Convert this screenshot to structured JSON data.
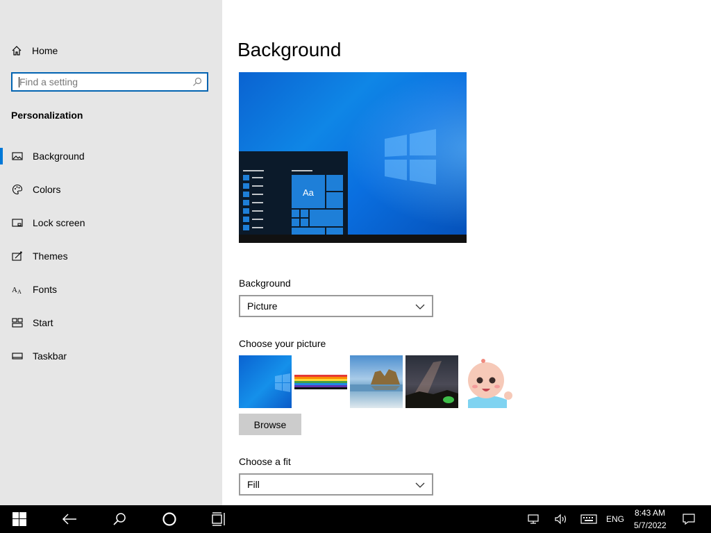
{
  "sidebar": {
    "home_label": "Home",
    "search": {
      "placeholder": "Find a setting",
      "icon": "search-icon"
    },
    "section_title": "Personalization",
    "items": [
      {
        "label": "Background",
        "icon": "picture-icon",
        "active": true
      },
      {
        "label": "Colors",
        "icon": "palette-icon",
        "active": false
      },
      {
        "label": "Lock screen",
        "icon": "lock-screen-icon",
        "active": false
      },
      {
        "label": "Themes",
        "icon": "themes-icon",
        "active": false
      },
      {
        "label": "Fonts",
        "icon": "fonts-icon",
        "active": false
      },
      {
        "label": "Start",
        "icon": "start-icon",
        "active": false
      },
      {
        "label": "Taskbar",
        "icon": "taskbar-icon",
        "active": false
      }
    ]
  },
  "main": {
    "title": "Background",
    "preview_tile_text": "Aa",
    "background_label": "Background",
    "background_value": "Picture",
    "choose_picture_label": "Choose your picture",
    "browse_label": "Browse",
    "fit_label": "Choose a fit",
    "fit_value": "Fill"
  },
  "taskbar": {
    "language": "ENG",
    "time": "8:43 AM",
    "date": "5/7/2022"
  },
  "colors": {
    "accent": "#0078d7",
    "sidebar_bg": "#e6e6e6",
    "taskbar_bg": "#000000"
  }
}
